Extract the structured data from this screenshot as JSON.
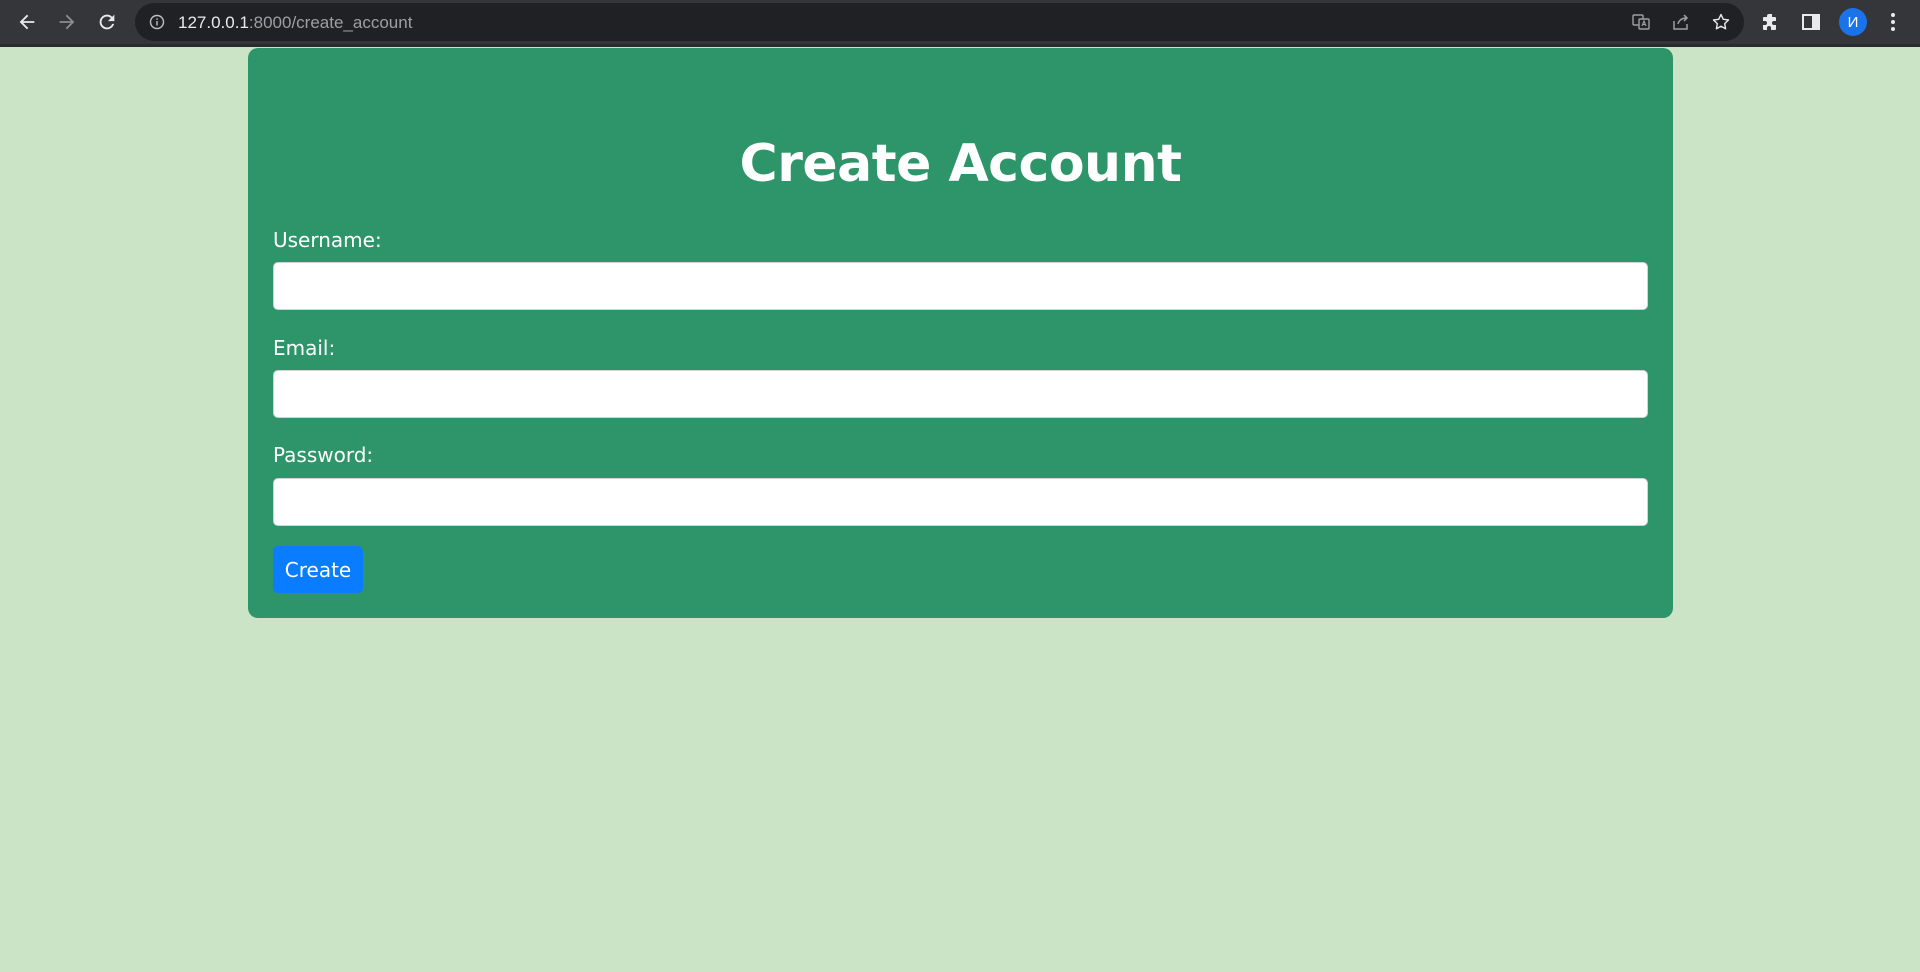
{
  "browser": {
    "url_host": "127.0.0.1",
    "url_rest": ":8000/create_account",
    "avatar_letter": "И"
  },
  "form": {
    "title": "Create Account",
    "username_label": "Username:",
    "username_value": "",
    "email_label": "Email:",
    "email_value": "",
    "password_label": "Password:",
    "password_value": "",
    "submit_label": "Create"
  },
  "colors": {
    "page_background": "#cbe4c6",
    "card_background": "#2e956a",
    "button_primary": "#0a7cff",
    "browser_chrome": "#35363a"
  }
}
